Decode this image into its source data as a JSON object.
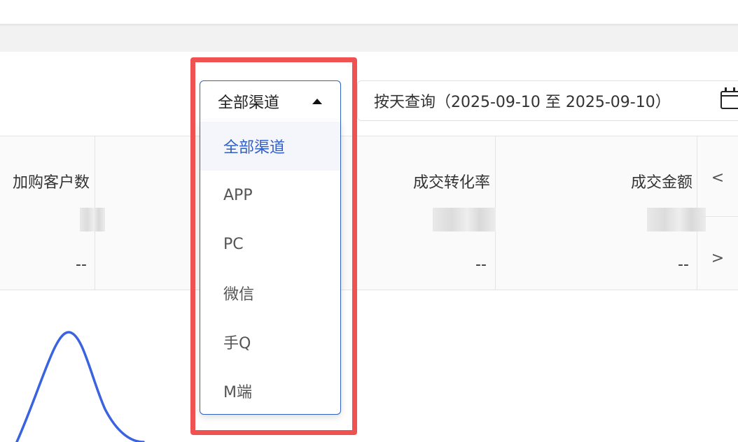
{
  "channel_select": {
    "value": "全部渠道",
    "options": [
      "全部渠道",
      "APP",
      "PC",
      "微信",
      "手Q",
      "M端"
    ]
  },
  "date_query": {
    "label": "按天查询（2025-09-10 至 2025-09-10）"
  },
  "metrics": [
    {
      "label": "加购客户数",
      "value": "--"
    },
    {
      "label": "成交转化率",
      "value": "--"
    },
    {
      "label": "成交金额",
      "value": "--"
    }
  ],
  "pager": {
    "prev": "<",
    "next": ">"
  },
  "colors": {
    "accent": "#2f5fc9",
    "highlight": "#f05252",
    "line": "#3a63e0"
  }
}
